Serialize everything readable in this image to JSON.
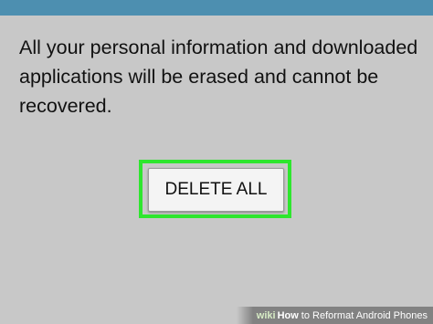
{
  "colors": {
    "background": "#c8c8c8",
    "top_bar": "#4d8fb0",
    "highlight": "#2ee62e",
    "button_bg": "#f4f4f4",
    "text": "#111111"
  },
  "dialog": {
    "message": "All your personal information and downloaded applications will be erased and cannot be recovered.",
    "delete_button_label": "DELETE ALL"
  },
  "watermark": {
    "logo": "wiki",
    "how": "How",
    "title": "to Reformat Android Phones"
  }
}
